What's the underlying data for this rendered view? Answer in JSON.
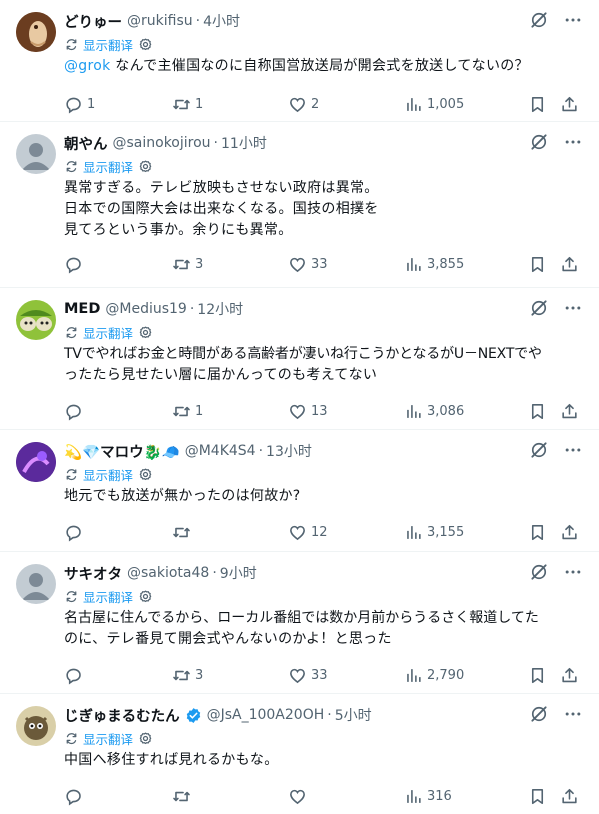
{
  "translate_label": "显示翻译",
  "tweets": [
    {
      "name": "どりゅー",
      "handle": "@rukifisu",
      "time": "4小时",
      "mention": "@grok",
      "text": " なんで主催国なのに自称国営放送局が開会式を放送してないの？",
      "replies": "1",
      "retweets": "1",
      "likes": "2",
      "views": "1,005"
    },
    {
      "name": "朝やん",
      "handle": "@sainokojirou",
      "time": "11小时",
      "text_lines": [
        "異常すぎる。テレビ放映もさせない政府は異常。",
        "日本での国際大会は出来なくなる。国技の相撲を",
        "見てろという事か。余りにも異常。"
      ],
      "replies": "",
      "retweets": "3",
      "likes": "33",
      "views": "3,855"
    },
    {
      "name": "MED",
      "handle": "@Medius19",
      "time": "12小时",
      "text_lines": [
        "TVでやればお金と時間がある高齢者が凄いね行こうかとなるがU－NEXTでや",
        "ったたら見せたい層に届かんってのも考えてない"
      ],
      "replies": "",
      "retweets": "1",
      "likes": "13",
      "views": "3,086"
    },
    {
      "name": "💫💎マロウ🐉🧢",
      "handle": "@M4K4S4",
      "time": "13小时",
      "text_lines": [
        "地元でも放送が無かったのは何故か?"
      ],
      "replies": "",
      "retweets": "",
      "likes": "12",
      "views": "3,155"
    },
    {
      "name": "サキオタ",
      "handle": "@sakiota48",
      "time": "9小时",
      "text_lines": [
        "名古屋に住んでるから、ローカル番組では数か月前からうるさく報道してた",
        "のに、テレ番見て開会式やんないのかよ！と思った"
      ],
      "replies": "",
      "retweets": "3",
      "likes": "33",
      "views": "2,790"
    },
    {
      "name": "じぎゅまるむたん",
      "handle": "@JsA_100A20OH",
      "time": "5小时",
      "text_lines": [
        "中国へ移住すれば見れるかもな。"
      ],
      "replies": "",
      "retweets": "",
      "likes": "",
      "views": "316"
    }
  ],
  "colors": {
    "accent": "#1d9bf0",
    "secondary_text": "#536471",
    "verified": "#1d9bf0"
  }
}
